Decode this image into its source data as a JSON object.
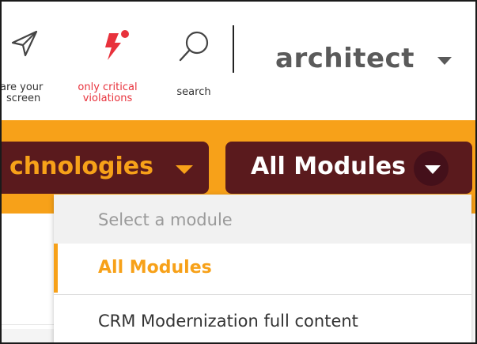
{
  "toolbar": {
    "share": {
      "icon": "paper-plane-icon",
      "line1": "are your",
      "line2": "screen"
    },
    "critical": {
      "icon": "lightning-alert-icon",
      "line1": "only critical",
      "line2": "violations",
      "color": "#e8323c"
    },
    "search": {
      "icon": "search-icon",
      "label": "search"
    },
    "user": {
      "name": "architect"
    }
  },
  "filters": {
    "technologies_label": "chnologies",
    "modules_label": "All Modules"
  },
  "module_dropdown": {
    "header": "Select a module",
    "options": [
      {
        "label": "All Modules",
        "selected": true
      },
      {
        "label": "CRM Modernization full content",
        "selected": false
      }
    ]
  },
  "colors": {
    "accent": "#f7a119",
    "pill_bg": "#5a1a1d",
    "alert": "#e8323c"
  }
}
